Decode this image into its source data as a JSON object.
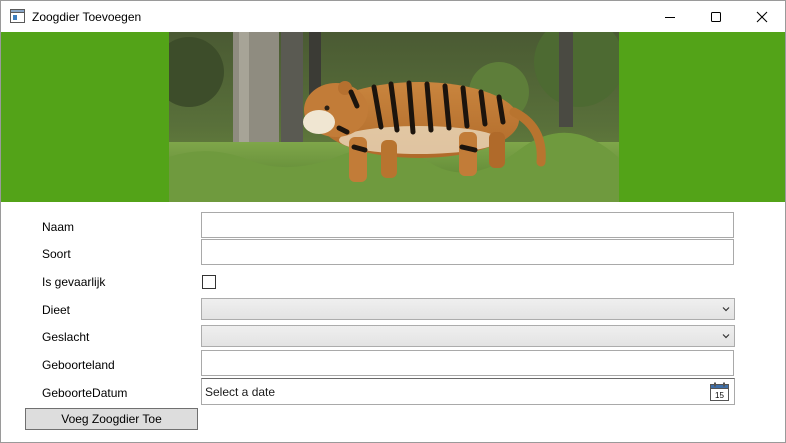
{
  "window": {
    "title": "Zoogdier Toevoegen",
    "controls": {
      "minimize": "minimize-icon",
      "maximize": "maximize-icon",
      "close": "close-icon"
    }
  },
  "banner": {
    "background": "#53a318",
    "image": "tiger-photo"
  },
  "form": {
    "naam": {
      "label": "Naam",
      "value": ""
    },
    "soort": {
      "label": "Soort",
      "value": ""
    },
    "is_gevaarlijk": {
      "label": "Is gevaarlijk",
      "checked": false
    },
    "dieet": {
      "label": "Dieet",
      "selected": ""
    },
    "geslacht": {
      "label": "Geslacht",
      "selected": ""
    },
    "geboorteland": {
      "label": "Geboorteland",
      "value": ""
    },
    "geboortedatum": {
      "label": "GeboorteDatum",
      "placeholder": "Select a date",
      "calendar_day": "15"
    },
    "submit_label": "Voeg Zoogdier Toe"
  }
}
